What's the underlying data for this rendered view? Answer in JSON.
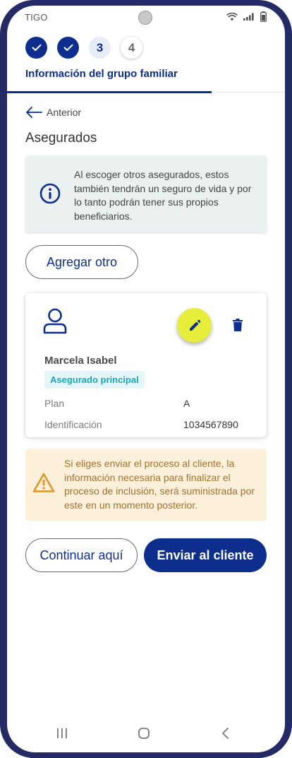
{
  "status_bar": {
    "carrier": "TIGO"
  },
  "stepper": {
    "steps": [
      {
        "state": "done",
        "label": ""
      },
      {
        "state": "done",
        "label": ""
      },
      {
        "state": "current",
        "label": "3"
      },
      {
        "state": "pending",
        "label": "4"
      }
    ],
    "title": "Información del grupo familiar"
  },
  "back_link": {
    "label": "Anterior"
  },
  "section_title": "Asegurados",
  "info_box": {
    "icon": "info-circle-icon",
    "text": "Al escoger otros asegurados, estos también tendrán un seguro de vida y por lo tanto podrán tener sus propios beneficiarios."
  },
  "add_button": {
    "label": "Agregar otro"
  },
  "insured_card": {
    "name": "Marcela Isabel",
    "badge": "Asegurado principal",
    "rows": [
      {
        "label": "Plan",
        "value": "A"
      },
      {
        "label": "Identificación",
        "value": "1034567890"
      }
    ],
    "edit_color": "#e6ed3a"
  },
  "warning_box": {
    "icon": "warning-triangle-icon",
    "text": "Si eliges enviar el proceso al cliente, la información necesaria para finalizar el proceso de inclusión, será suministrada por este en un momento posterior."
  },
  "actions": {
    "continue_label": "Continuar aquí",
    "send_label": "Enviar al cliente"
  },
  "colors": {
    "primary": "#0d2e8c",
    "accent": "#e6ed3a",
    "badge_text": "#1aa7b2",
    "warning_text": "#a0702c",
    "frame": "#242a66"
  }
}
